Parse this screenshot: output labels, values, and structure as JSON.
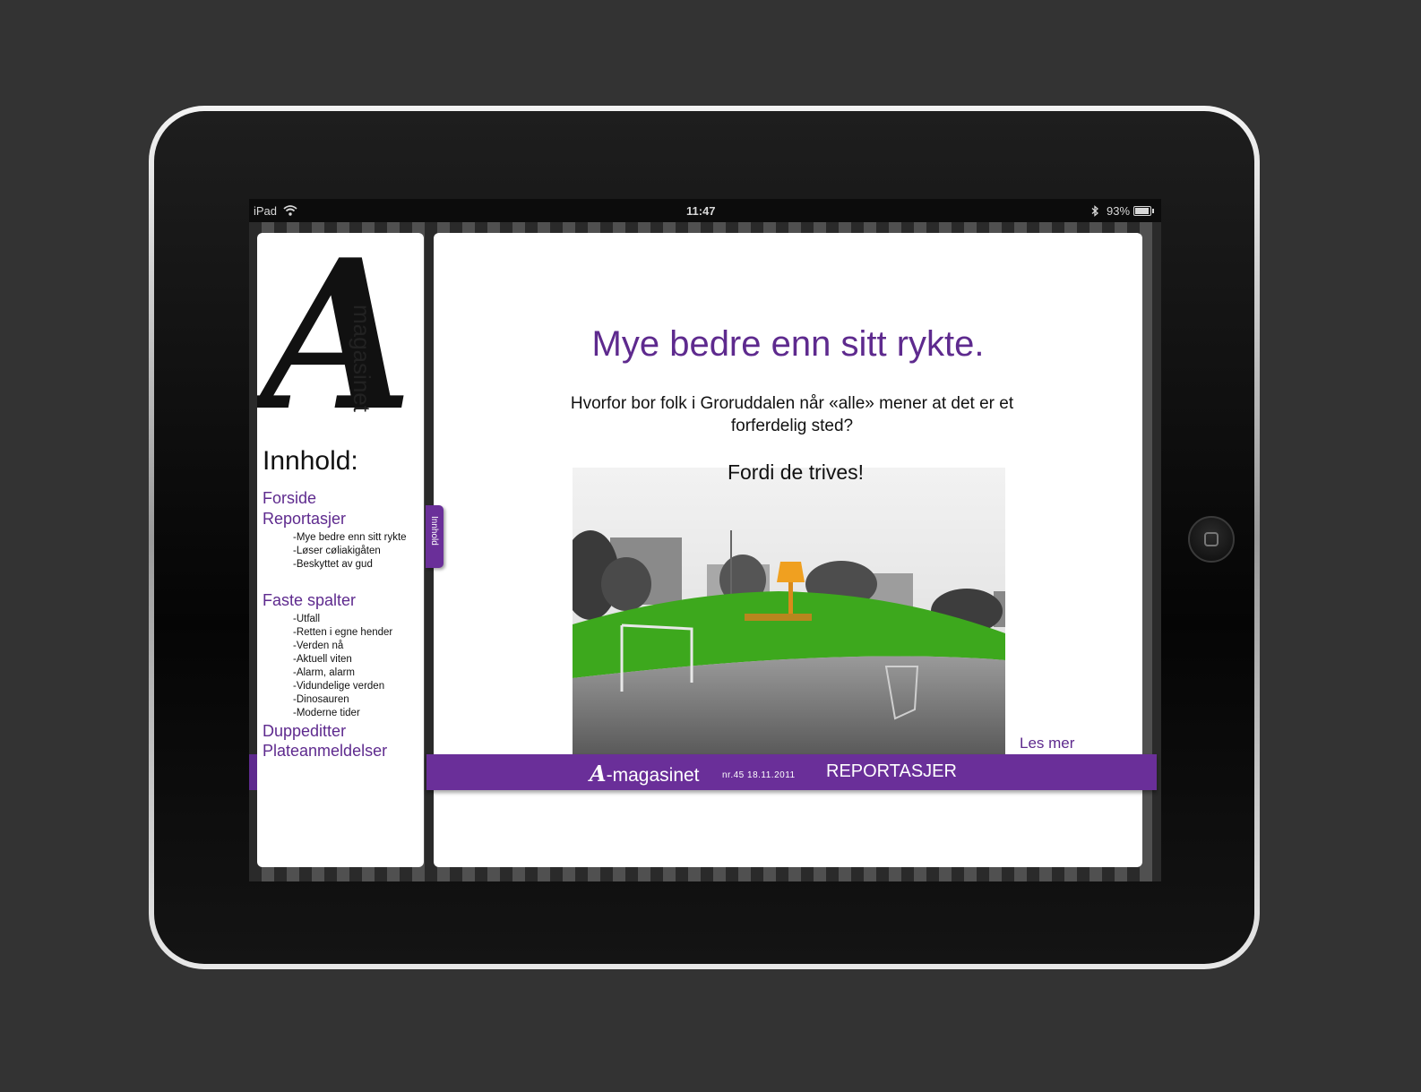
{
  "status_bar": {
    "device": "iPad",
    "time": "11:47",
    "battery": "93%"
  },
  "sidebar": {
    "logo_letter": "A",
    "logo_word": "magasinet",
    "title": "Innhold:",
    "sections": [
      {
        "label": "Forside"
      },
      {
        "label": "Reportasjer",
        "items": [
          "-Mye bedre enn sitt rykte",
          "-Løser cøliakigåten",
          "-Beskyttet av gud"
        ]
      },
      {
        "label": "Faste spalter",
        "items": [
          "-Utfall",
          "-Retten i egne hender",
          "-Verden nå",
          "-Aktuell viten",
          "-Alarm, alarm",
          "-Vidundelige verden",
          "-Dinosauren",
          "-Moderne tider"
        ]
      },
      {
        "label": "Duppeditter"
      },
      {
        "label": "Plateanmeldelser"
      }
    ]
  },
  "tab": {
    "label": "Innhold"
  },
  "article": {
    "headline": "Mye bedre enn sitt rykte.",
    "lead": "Hvorfor bor folk i Groruddalen når «alle» mener at det er et forferdelig sted?",
    "sublead": "Fordi de trives!",
    "read_more": "Les mer"
  },
  "footer": {
    "brand_letter": "A",
    "brand_rest": "-magasinet",
    "issue": "nr.45  18.11.2011",
    "section": "REPORTASJER"
  },
  "colors": {
    "accent": "#5e2a8e",
    "band": "#6a2f99"
  }
}
